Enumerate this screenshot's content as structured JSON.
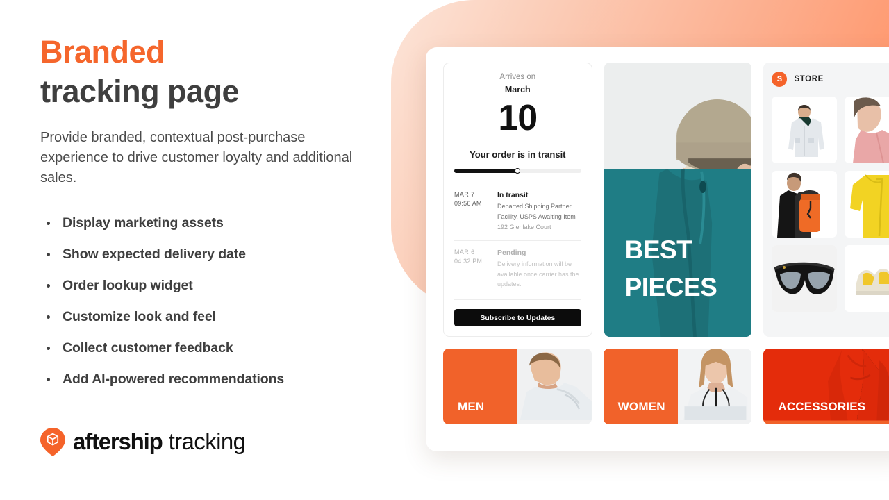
{
  "hero": {
    "headline_accent": "Branded",
    "headline_rest": "tracking page",
    "subcopy": "Provide branded, contextual post-purchase experience to drive customer loyalty and additional sales.",
    "bullets": [
      "Display marketing assets",
      "Show expected delivery date",
      "Order lookup widget",
      "Customize look and feel",
      "Collect customer feedback",
      "Add AI-powered recommendations"
    ]
  },
  "logo": {
    "mark": "aftership-pin-icon",
    "word_bold": "aftership",
    "word_light": "tracking"
  },
  "colors": {
    "accent_orange": "#f5662c",
    "tile_orange": "#f1622a",
    "teal": "#1f7d85",
    "text_dark": "#3f3f3f",
    "black": "#0c0c0c"
  },
  "tracking": {
    "arrives_label": "Arrives on",
    "month": "March",
    "day": "10",
    "status": "Your order is in transit",
    "progress_percent": 50,
    "events": [
      {
        "date": "MAR 7",
        "time": "09:56 AM",
        "title": "In transit",
        "desc": "Departed Shipping Partner Facility, USPS Awaiting Item",
        "location": "192 Glenlake Court",
        "state": "active"
      },
      {
        "date": "MAR 6",
        "time": "04:32 PM",
        "title": "Pending",
        "desc": "Delivery information will be available once carrier has the updates.",
        "location": "",
        "state": "muted"
      }
    ],
    "subscribe_label": "Subscribe to Updates"
  },
  "promo": {
    "line1": "BEST",
    "line2": "PIECES",
    "image": "bucket-hat-model-photo"
  },
  "store": {
    "avatar_letter": "S",
    "name": "STORE",
    "products": [
      {
        "image": "white-jacket-product-photo"
      },
      {
        "image": "pink-shirt-product-photo"
      },
      {
        "image": "orange-backpack-product-photo"
      },
      {
        "image": "yellow-jacket-product-photo"
      },
      {
        "image": "black-sunglasses-product-photo"
      },
      {
        "image": "yellow-sneakers-product-photo"
      }
    ]
  },
  "categories": [
    {
      "label": "MEN",
      "image": "man-white-jacket-photo",
      "style": "split"
    },
    {
      "label": "WOMEN",
      "image": "woman-white-jacket-photo",
      "style": "split"
    },
    {
      "label": "ACCESSORIES",
      "image": "orange-coat-photo",
      "style": "full"
    }
  ]
}
